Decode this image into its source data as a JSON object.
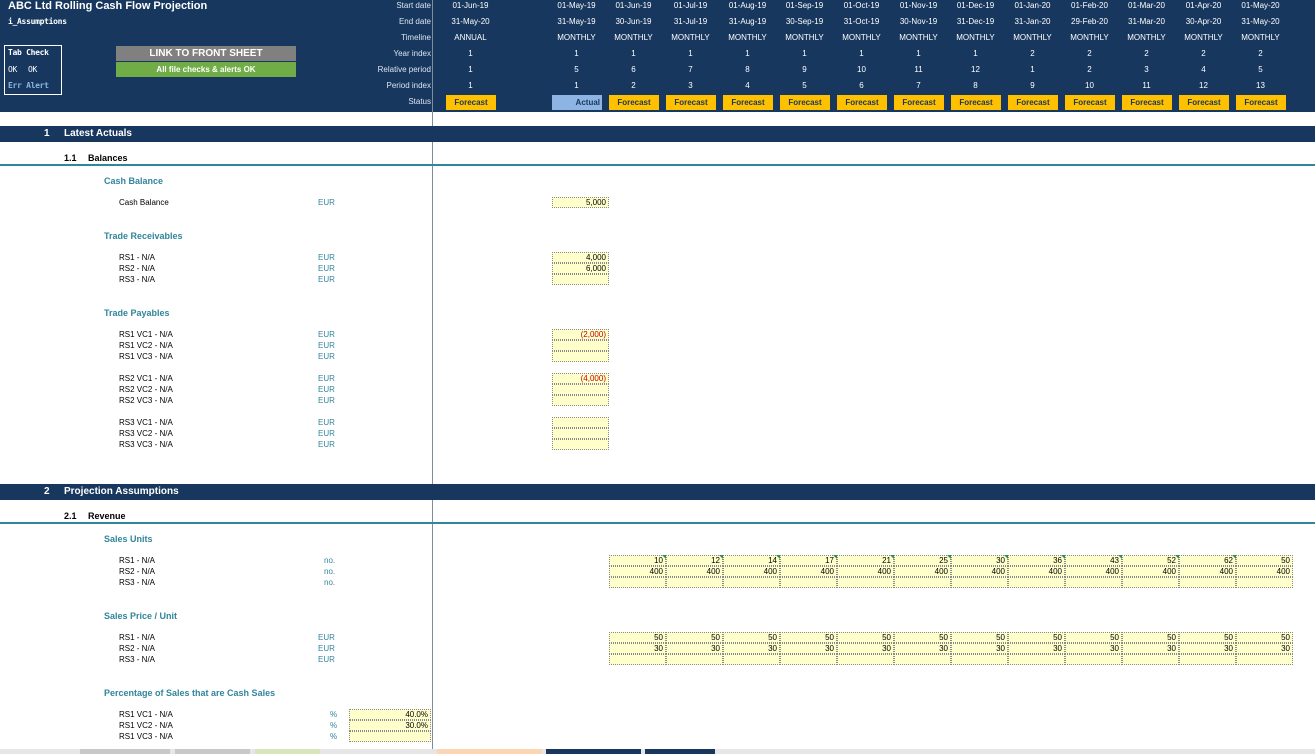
{
  "header": {
    "title": "ABC Ltd Rolling Cash Flow Projection",
    "sheet_name": "i_Assumptions",
    "row_labels": [
      "Start date",
      "End date",
      "Timeline",
      "Year index",
      "Relative period",
      "Period index",
      "Status"
    ],
    "annual": {
      "start": "01-Jun-19",
      "end": "31-May-20",
      "timeline": "ANNUAL",
      "year": "1",
      "relative": "1",
      "period": "1",
      "status": "Forecast"
    },
    "months": [
      {
        "start": "01-May-19",
        "end": "31-May-19",
        "timeline": "MONTHLY",
        "year": "1",
        "relative": "5",
        "period": "1",
        "status": "Actual"
      },
      {
        "start": "01-Jun-19",
        "end": "30-Jun-19",
        "timeline": "MONTHLY",
        "year": "1",
        "relative": "6",
        "period": "2",
        "status": "Forecast"
      },
      {
        "start": "01-Jul-19",
        "end": "31-Jul-19",
        "timeline": "MONTHLY",
        "year": "1",
        "relative": "7",
        "period": "3",
        "status": "Forecast"
      },
      {
        "start": "01-Aug-19",
        "end": "31-Aug-19",
        "timeline": "MONTHLY",
        "year": "1",
        "relative": "8",
        "period": "4",
        "status": "Forecast"
      },
      {
        "start": "01-Sep-19",
        "end": "30-Sep-19",
        "timeline": "MONTHLY",
        "year": "1",
        "relative": "9",
        "period": "5",
        "status": "Forecast"
      },
      {
        "start": "01-Oct-19",
        "end": "31-Oct-19",
        "timeline": "MONTHLY",
        "year": "1",
        "relative": "10",
        "period": "6",
        "status": "Forecast"
      },
      {
        "start": "01-Nov-19",
        "end": "30-Nov-19",
        "timeline": "MONTHLY",
        "year": "1",
        "relative": "11",
        "period": "7",
        "status": "Forecast"
      },
      {
        "start": "01-Dec-19",
        "end": "31-Dec-19",
        "timeline": "MONTHLY",
        "year": "1",
        "relative": "12",
        "period": "8",
        "status": "Forecast"
      },
      {
        "start": "01-Jan-20",
        "end": "31-Jan-20",
        "timeline": "MONTHLY",
        "year": "2",
        "relative": "1",
        "period": "9",
        "status": "Forecast"
      },
      {
        "start": "01-Feb-20",
        "end": "29-Feb-20",
        "timeline": "MONTHLY",
        "year": "2",
        "relative": "2",
        "period": "10",
        "status": "Forecast"
      },
      {
        "start": "01-Mar-20",
        "end": "31-Mar-20",
        "timeline": "MONTHLY",
        "year": "2",
        "relative": "3",
        "period": "11",
        "status": "Forecast"
      },
      {
        "start": "01-Apr-20",
        "end": "30-Apr-20",
        "timeline": "MONTHLY",
        "year": "2",
        "relative": "4",
        "period": "12",
        "status": "Forecast"
      },
      {
        "start": "01-May-20",
        "end": "31-May-20",
        "timeline": "MONTHLY",
        "year": "2",
        "relative": "5",
        "period": "13",
        "status": "Forecast"
      }
    ]
  },
  "tab_check": {
    "title": "Tab Check",
    "ok1": "OK",
    "ok2": "OK",
    "alert": "Err Alert"
  },
  "buttons": {
    "front_sheet": "LINK TO FRONT SHEET",
    "file_checks": "All file checks & alerts OK"
  },
  "sections": {
    "s1": {
      "num": "1",
      "label": "Latest Actuals"
    },
    "s1_1": {
      "num": "1.1",
      "label": "Balances"
    },
    "s2": {
      "num": "2",
      "label": "Projection Assumptions"
    },
    "s2_1": {
      "num": "2.1",
      "label": "Revenue"
    }
  },
  "groups": {
    "cash": "Cash Balance",
    "receivables": "Trade Receivables",
    "payables": "Trade Payables",
    "units": "Sales Units",
    "price": "Sales Price / Unit",
    "cash_sales": "Percentage of Sales that are Cash Sales"
  },
  "cash_rows": [
    {
      "label": "Cash Balance",
      "unit": "EUR",
      "value": "5,000"
    }
  ],
  "receivable_rows": [
    {
      "label": "RS1 - N/A",
      "unit": "EUR",
      "value": "4,000"
    },
    {
      "label": "RS2 - N/A",
      "unit": "EUR",
      "value": "6,000"
    },
    {
      "label": "RS3 - N/A",
      "unit": "EUR",
      "value": ""
    }
  ],
  "payable_blocks": [
    [
      {
        "label": "RS1 VC1 - N/A",
        "unit": "EUR",
        "value": "(2,000)"
      },
      {
        "label": "RS1 VC2 - N/A",
        "unit": "EUR",
        "value": ""
      },
      {
        "label": "RS1 VC3 - N/A",
        "unit": "EUR",
        "value": ""
      }
    ],
    [
      {
        "label": "RS2 VC1 - N/A",
        "unit": "EUR",
        "value": "(4,000)"
      },
      {
        "label": "RS2 VC2 - N/A",
        "unit": "EUR",
        "value": ""
      },
      {
        "label": "RS2 VC3 - N/A",
        "unit": "EUR",
        "value": ""
      }
    ],
    [
      {
        "label": "RS3 VC1 - N/A",
        "unit": "EUR",
        "value": ""
      },
      {
        "label": "RS3 VC2 - N/A",
        "unit": "EUR",
        "value": ""
      },
      {
        "label": "RS3 VC3 - N/A",
        "unit": "EUR",
        "value": ""
      }
    ]
  ],
  "sales_units": [
    {
      "label": "RS1 - N/A",
      "unit": "no.",
      "values": [
        "10",
        "12",
        "14",
        "17",
        "21",
        "25",
        "30",
        "36",
        "43",
        "52",
        "62",
        "50"
      ]
    },
    {
      "label": "RS2 - N/A",
      "unit": "no.",
      "values": [
        "400",
        "400",
        "400",
        "400",
        "400",
        "400",
        "400",
        "400",
        "400",
        "400",
        "400",
        "400"
      ]
    },
    {
      "label": "RS3 - N/A",
      "unit": "no.",
      "values": [
        "",
        "",
        "",
        "",
        "",
        "",
        "",
        "",
        "",
        "",
        "",
        ""
      ]
    }
  ],
  "sales_price": [
    {
      "label": "RS1 - N/A",
      "unit": "EUR",
      "values": [
        "50",
        "50",
        "50",
        "50",
        "50",
        "50",
        "50",
        "50",
        "50",
        "50",
        "50",
        "50"
      ]
    },
    {
      "label": "RS2 - N/A",
      "unit": "EUR",
      "values": [
        "30",
        "30",
        "30",
        "30",
        "30",
        "30",
        "30",
        "30",
        "30",
        "30",
        "30",
        "30"
      ]
    },
    {
      "label": "RS3 - N/A",
      "unit": "EUR",
      "values": [
        "",
        "",
        "",
        "",
        "",
        "",
        "",
        "",
        "",
        "",
        "",
        ""
      ]
    }
  ],
  "cash_sales_rows": [
    {
      "label": "RS1 VC1 - N/A",
      "unit": "%",
      "value": "40.0%"
    },
    {
      "label": "RS1 VC2 - N/A",
      "unit": "%",
      "value": "30.0%"
    },
    {
      "label": "RS1 VC3 - N/A",
      "unit": "%",
      "value": ""
    }
  ],
  "colors": {
    "header_bg": "#17375e",
    "forecast": "#ffc000",
    "actual": "#8db4e2",
    "input_fill": "#ffffcc",
    "accent": "#31859c",
    "check_ok": "#70ad47",
    "negative": "#c00000"
  }
}
